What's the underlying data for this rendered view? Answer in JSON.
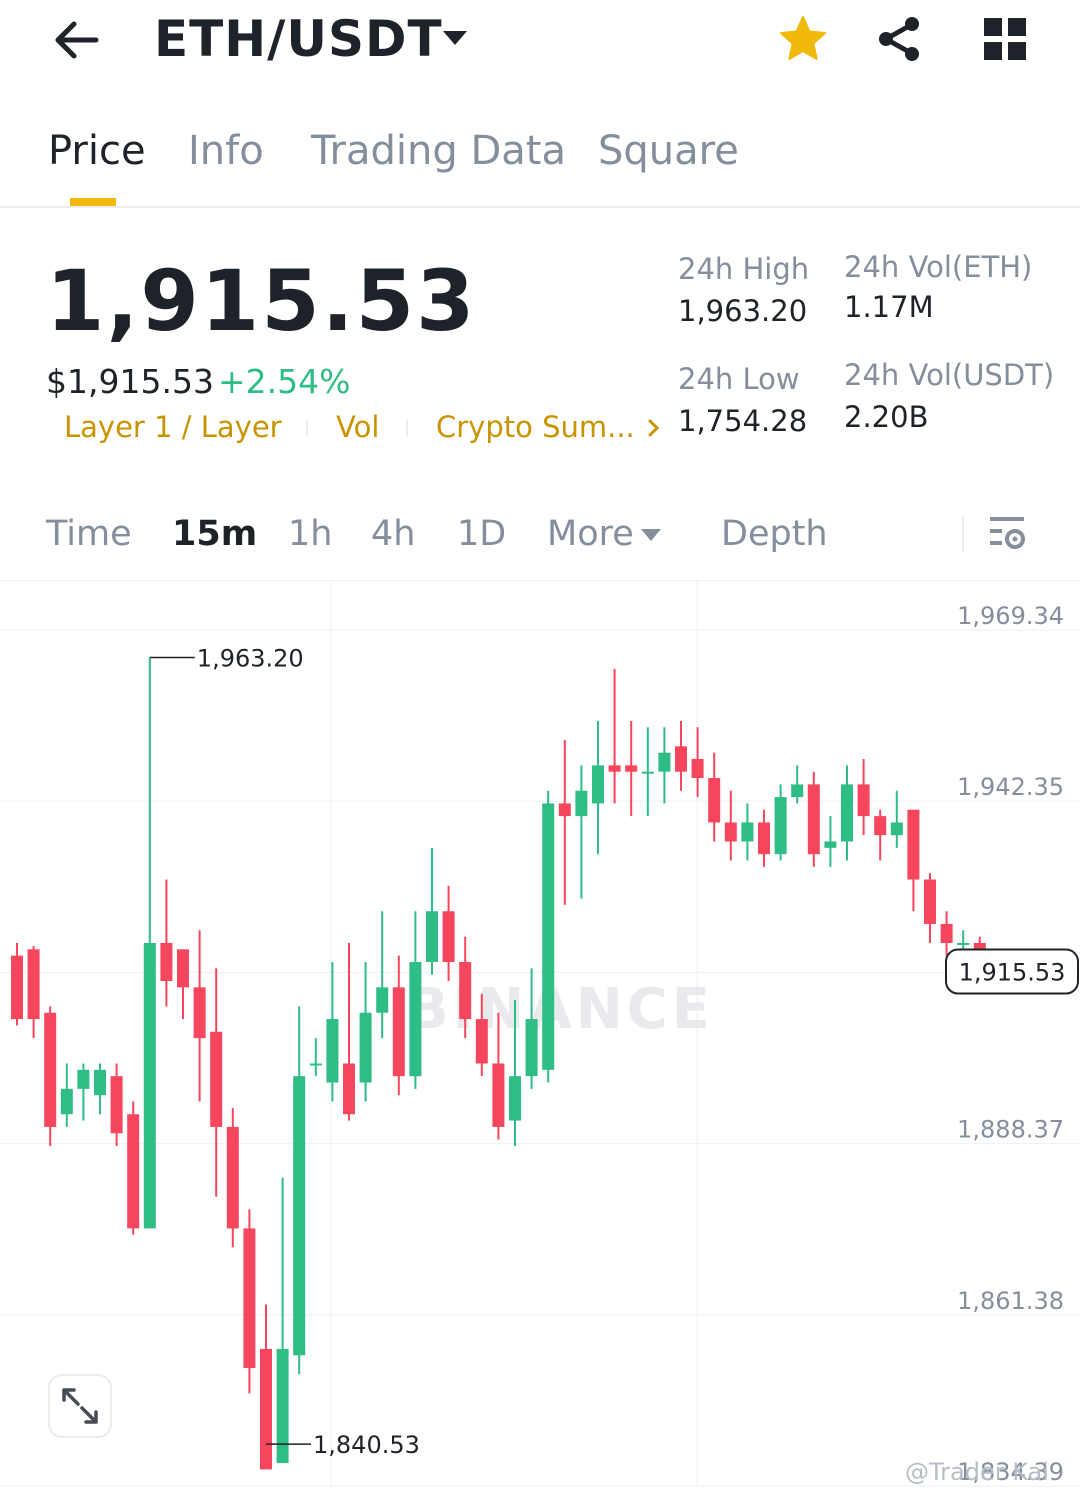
{
  "header": {
    "pair": "ETH/USDT",
    "icons": [
      "back-arrow-icon",
      "caret-down-icon",
      "star-icon",
      "share-icon",
      "grid-apps-icon"
    ],
    "star_color": "#f0b90b"
  },
  "tabs": [
    {
      "label": "Price",
      "active": true
    },
    {
      "label": "Info",
      "active": false
    },
    {
      "label": "Trading Data",
      "active": false
    },
    {
      "label": "Square",
      "active": false
    }
  ],
  "ticker": {
    "last_price": "1,915.53",
    "usd_price": "$1,915.53",
    "change": "+2.54%",
    "tags": [
      "Layer 1 / Layer",
      "Vol",
      "Crypto Sum..."
    ],
    "stats": {
      "high_label": "24h High",
      "high_value": "1,963.20",
      "low_label": "24h Low",
      "low_value": "1,754.28",
      "vol_eth_label": "24h Vol(ETH)",
      "vol_eth_value": "1.17M",
      "vol_usdt_label": "24h Vol(USDT)",
      "vol_usdt_value": "2.20B"
    }
  },
  "intervals": {
    "items": [
      "Time",
      "15m",
      "1h",
      "4h",
      "1D",
      "More",
      "Depth"
    ],
    "active": "15m"
  },
  "colors": {
    "up": "#2ebd85",
    "down": "#f6465d",
    "accent": "#f0b90b",
    "tag": "#c99400",
    "muted": "#848e9c"
  },
  "chart_data": {
    "type": "candlestick",
    "y_ticks": [
      "1,969.34",
      "1,942.35",
      "1,915.36",
      "1,888.37",
      "1,861.38",
      "1,834.39"
    ],
    "ylim": [
      1834.39,
      1969.34
    ],
    "grid": true,
    "last_price_label": "1,915.53",
    "max_label": "1,963.20",
    "min_label": "1,840.53",
    "watermark": "BINANCE",
    "candles": [
      [
        1918,
        1908,
        1920,
        1907
      ],
      [
        1919,
        1908,
        1919.5,
        1905
      ],
      [
        1909,
        1891,
        1910,
        1888
      ],
      [
        1893,
        1897,
        1901,
        1891
      ],
      [
        1897,
        1900,
        1901,
        1892
      ],
      [
        1896,
        1900,
        1901,
        1893
      ],
      [
        1899,
        1890,
        1901,
        1888
      ],
      [
        1893,
        1875,
        1895,
        1874
      ],
      [
        1875,
        1920,
        1965,
        1875
      ],
      [
        1920,
        1914,
        1930,
        1910
      ],
      [
        1919,
        1913,
        1919,
        1908
      ],
      [
        1913,
        1905,
        1922,
        1895
      ],
      [
        1906,
        1891,
        1916,
        1880
      ],
      [
        1891,
        1875,
        1894,
        1872
      ],
      [
        1875,
        1853,
        1878,
        1849
      ],
      [
        1856,
        1837,
        1863,
        1841
      ],
      [
        1838,
        1856,
        1883,
        1841
      ],
      [
        1855,
        1899,
        1910,
        1852
      ],
      [
        1901,
        1901,
        1905,
        1899
      ],
      [
        1898,
        1908,
        1917,
        1895
      ],
      [
        1901,
        1893,
        1920,
        1892
      ],
      [
        1898,
        1909,
        1917,
        1895
      ],
      [
        1909,
        1913,
        1925,
        1905
      ],
      [
        1913,
        1899,
        1918,
        1896
      ],
      [
        1899,
        1917,
        1925,
        1897
      ],
      [
        1917,
        1925,
        1935,
        1915
      ],
      [
        1925,
        1917,
        1929,
        1914
      ],
      [
        1917,
        1908,
        1921,
        1905
      ],
      [
        1908,
        1901,
        1912,
        1899
      ],
      [
        1901,
        1891,
        1909,
        1889
      ],
      [
        1892,
        1899,
        1911,
        1888
      ],
      [
        1899,
        1908,
        1916,
        1897
      ],
      [
        1900,
        1942,
        1944,
        1898
      ],
      [
        1942,
        1940,
        1952,
        1926
      ],
      [
        1940,
        1944,
        1948,
        1927
      ],
      [
        1942,
        1948,
        1955,
        1934
      ],
      [
        1948,
        1947,
        1963.2,
        1942
      ],
      [
        1948,
        1947,
        1955,
        1940
      ],
      [
        1947,
        1947,
        1954,
        1940
      ],
      [
        1947,
        1950,
        1954,
        1942
      ],
      [
        1951,
        1947,
        1955,
        1944
      ],
      [
        1949,
        1946,
        1954,
        1943
      ],
      [
        1946,
        1939,
        1950,
        1936
      ],
      [
        1939,
        1936,
        1944,
        1933
      ],
      [
        1936,
        1939,
        1942,
        1933
      ],
      [
        1939,
        1934,
        1941,
        1932
      ],
      [
        1934,
        1943,
        1945,
        1933
      ],
      [
        1943,
        1945,
        1948,
        1942
      ],
      [
        1945,
        1934,
        1947,
        1932
      ],
      [
        1935,
        1936,
        1940,
        1932
      ],
      [
        1936,
        1945,
        1948,
        1933
      ],
      [
        1945,
        1940,
        1949,
        1937
      ],
      [
        1940,
        1937,
        1941,
        1933
      ],
      [
        1937,
        1939,
        1944,
        1935
      ],
      [
        1941,
        1930,
        1941,
        1925
      ],
      [
        1930,
        1923,
        1931,
        1920
      ],
      [
        1923,
        1920,
        1925,
        1918
      ],
      [
        1920,
        1920,
        1922,
        1918
      ],
      [
        1920,
        1914,
        1921,
        1914
      ],
      [
        1917,
        1915.5,
        1919,
        1914
      ]
    ]
  },
  "watermark_text": "@Trader Kai"
}
